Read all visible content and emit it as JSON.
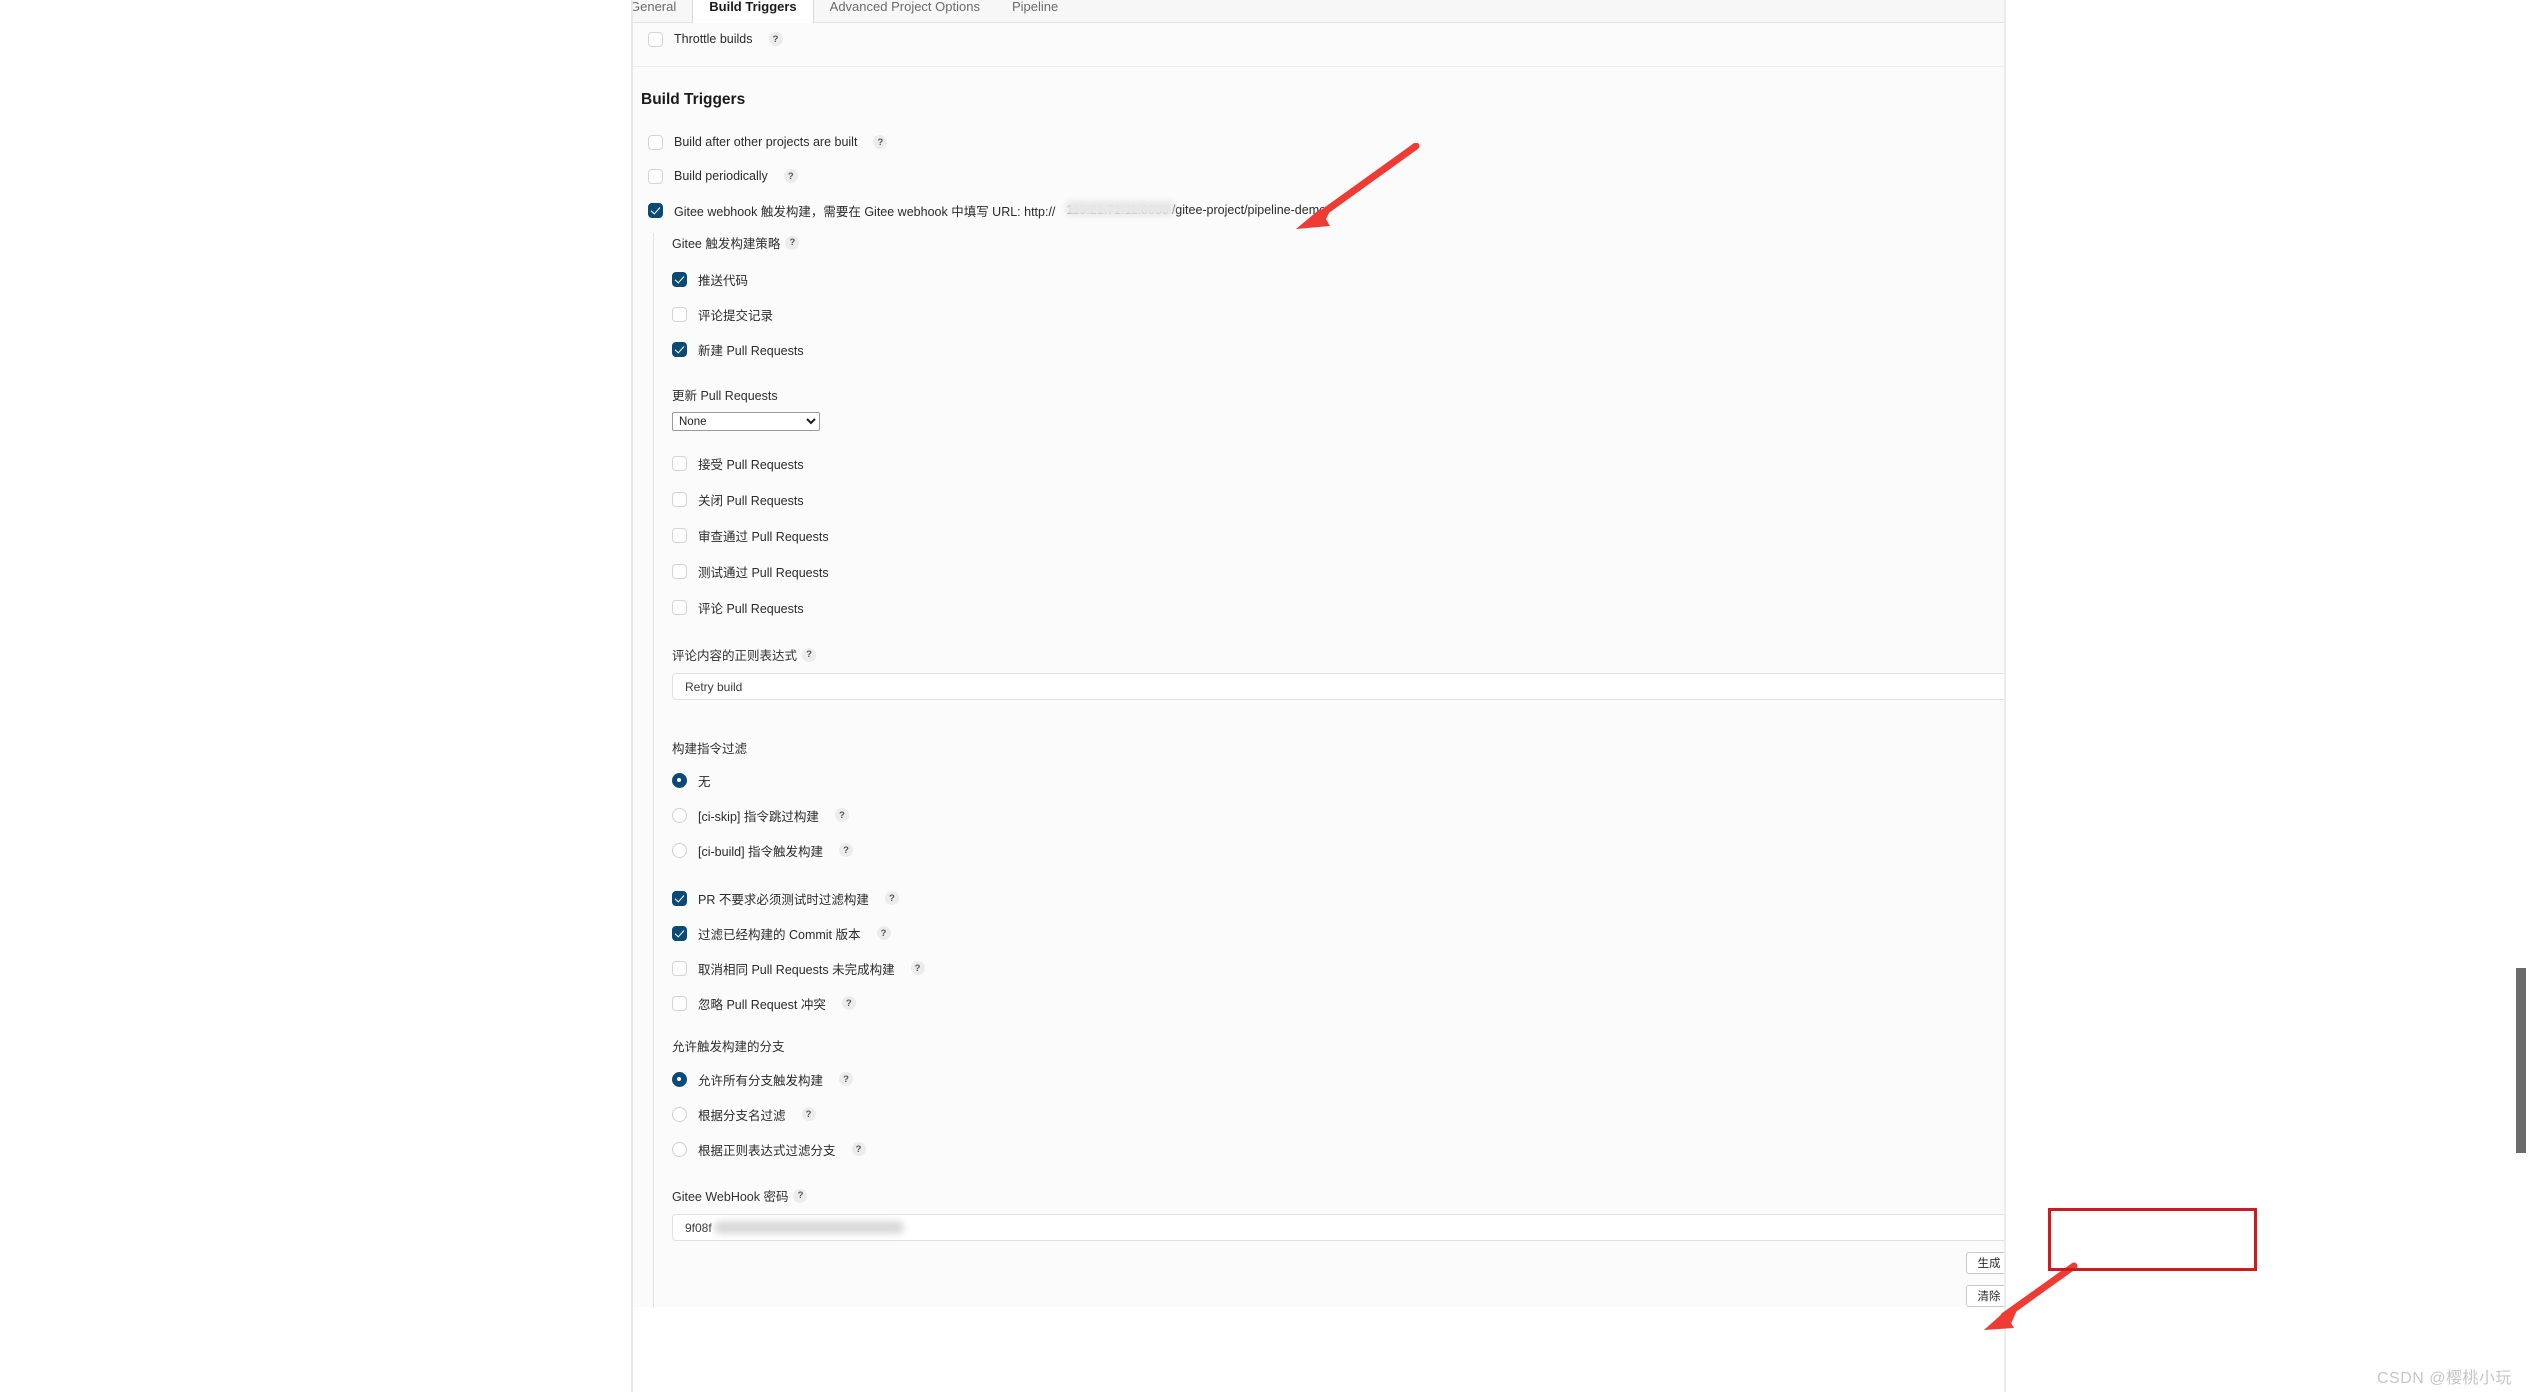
{
  "tabs": [
    {
      "label": "General",
      "active": false
    },
    {
      "label": "Build Triggers",
      "active": true
    },
    {
      "label": "Advanced Project Options",
      "active": false
    },
    {
      "label": "Pipeline",
      "active": false
    }
  ],
  "throttle": {
    "label": "Throttle builds",
    "help": "?",
    "checked": false
  },
  "section": {
    "title": "Build Triggers"
  },
  "top_triggers": [
    {
      "label": "Build after other projects are built",
      "checked": false,
      "help": "?"
    },
    {
      "label": "Build periodically",
      "checked": false,
      "help": "?"
    }
  ],
  "gitee": {
    "main_label": "Gitee webhook 触发构建，需要在 Gitee webhook 中填写 URL: http://",
    "url_redacted": "119.21.71.11:8080",
    "url_tail": "/gitee-project/pipeline-demo",
    "checked": true,
    "strategy_label": "Gitee 触发构建策略",
    "strategy_help": "?"
  },
  "event_checkboxes": [
    {
      "label": "推送代码",
      "checked": true
    },
    {
      "label": "评论提交记录",
      "checked": false
    },
    {
      "label": "新建 Pull Requests",
      "checked": true
    }
  ],
  "update_pr": {
    "label": "更新 Pull Requests",
    "selected": "None",
    "options": [
      "None"
    ]
  },
  "pr_checkboxes": [
    {
      "label": "接受 Pull Requests",
      "checked": false
    },
    {
      "label": "关闭 Pull Requests",
      "checked": false
    },
    {
      "label": "审查通过 Pull Requests",
      "checked": false
    },
    {
      "label": "测试通过 Pull Requests",
      "checked": false
    },
    {
      "label": "评论 Pull Requests",
      "checked": false
    }
  ],
  "comment_regex": {
    "label": "评论内容的正则表达式",
    "help": "?",
    "value": "Retry build",
    "placeholder": "Retry build"
  },
  "command_filter": {
    "label": "构建指令过滤",
    "options": [
      {
        "label": "无",
        "checked": true,
        "help": ""
      },
      {
        "label": "[ci-skip] 指令跳过构建",
        "checked": false,
        "help": "?"
      },
      {
        "label": "[ci-build] 指令触发构建",
        "checked": false,
        "help": "?"
      }
    ]
  },
  "filter_checkboxes": [
    {
      "label": "PR 不要求必须测试时过滤构建",
      "checked": true,
      "help": "?"
    },
    {
      "label": "过滤已经构建的 Commit 版本",
      "checked": true,
      "help": "?"
    },
    {
      "label": "取消相同 Pull Requests 未完成构建",
      "checked": false,
      "help": "?"
    },
    {
      "label": "忽略 Pull Request 冲突",
      "checked": false,
      "help": "?"
    }
  ],
  "branch_filter": {
    "label": "允许触发构建的分支",
    "options": [
      {
        "label": "允许所有分支触发构建",
        "checked": true,
        "help": "?"
      },
      {
        "label": "根据分支名过滤",
        "checked": false,
        "help": "?"
      },
      {
        "label": "根据正则表达式过滤分支",
        "checked": false,
        "help": "?"
      }
    ]
  },
  "webhook_password": {
    "label": "Gitee WebHook 密码",
    "help": "?",
    "value": "9f08f",
    "generate_label": "生成",
    "clear_label": "清除"
  },
  "watermark": "CSDN @樱桃小玩",
  "annotations": {
    "arrow_color": "#ee3b33",
    "rect_color": "#cc1c22"
  }
}
